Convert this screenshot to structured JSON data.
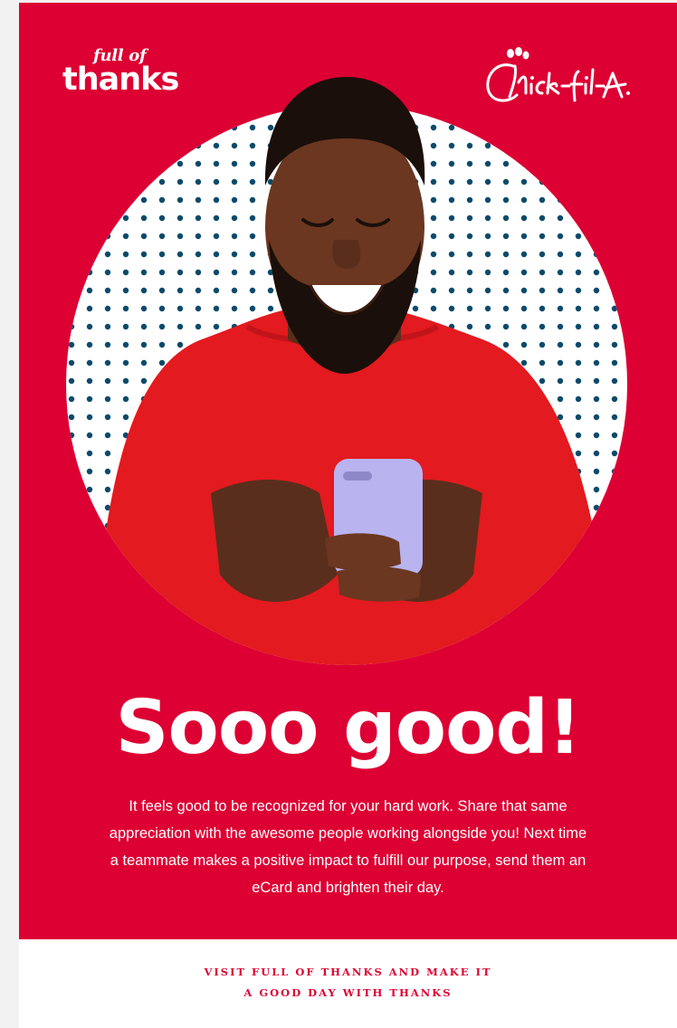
{
  "colors": {
    "brand_red": "#dd0033",
    "sweater_red": "#e31a1f",
    "dot_navy": "#0b4a6a",
    "white": "#ffffff"
  },
  "brand": {
    "campaign_small": "full of",
    "campaign_big": "thanks",
    "logo": "Chick-fil-A"
  },
  "hero": {
    "headline": "Sooo good!",
    "body": "It feels good to be recognized for your hard work. Share that same appreciation with the awesome people working alongside you! Next time a teammate makes a positive impact to fulfill our purpose, send them an eCard and brighten their day."
  },
  "footer": {
    "cta_line1": "VISIT FULL OF THANKS AND MAKE IT",
    "cta_line2": "A GOOD DAY WITH THANKS"
  },
  "icons": {
    "hero_image": "person-with-phone-image",
    "brand_logo": "chick-fil-a-logo"
  }
}
